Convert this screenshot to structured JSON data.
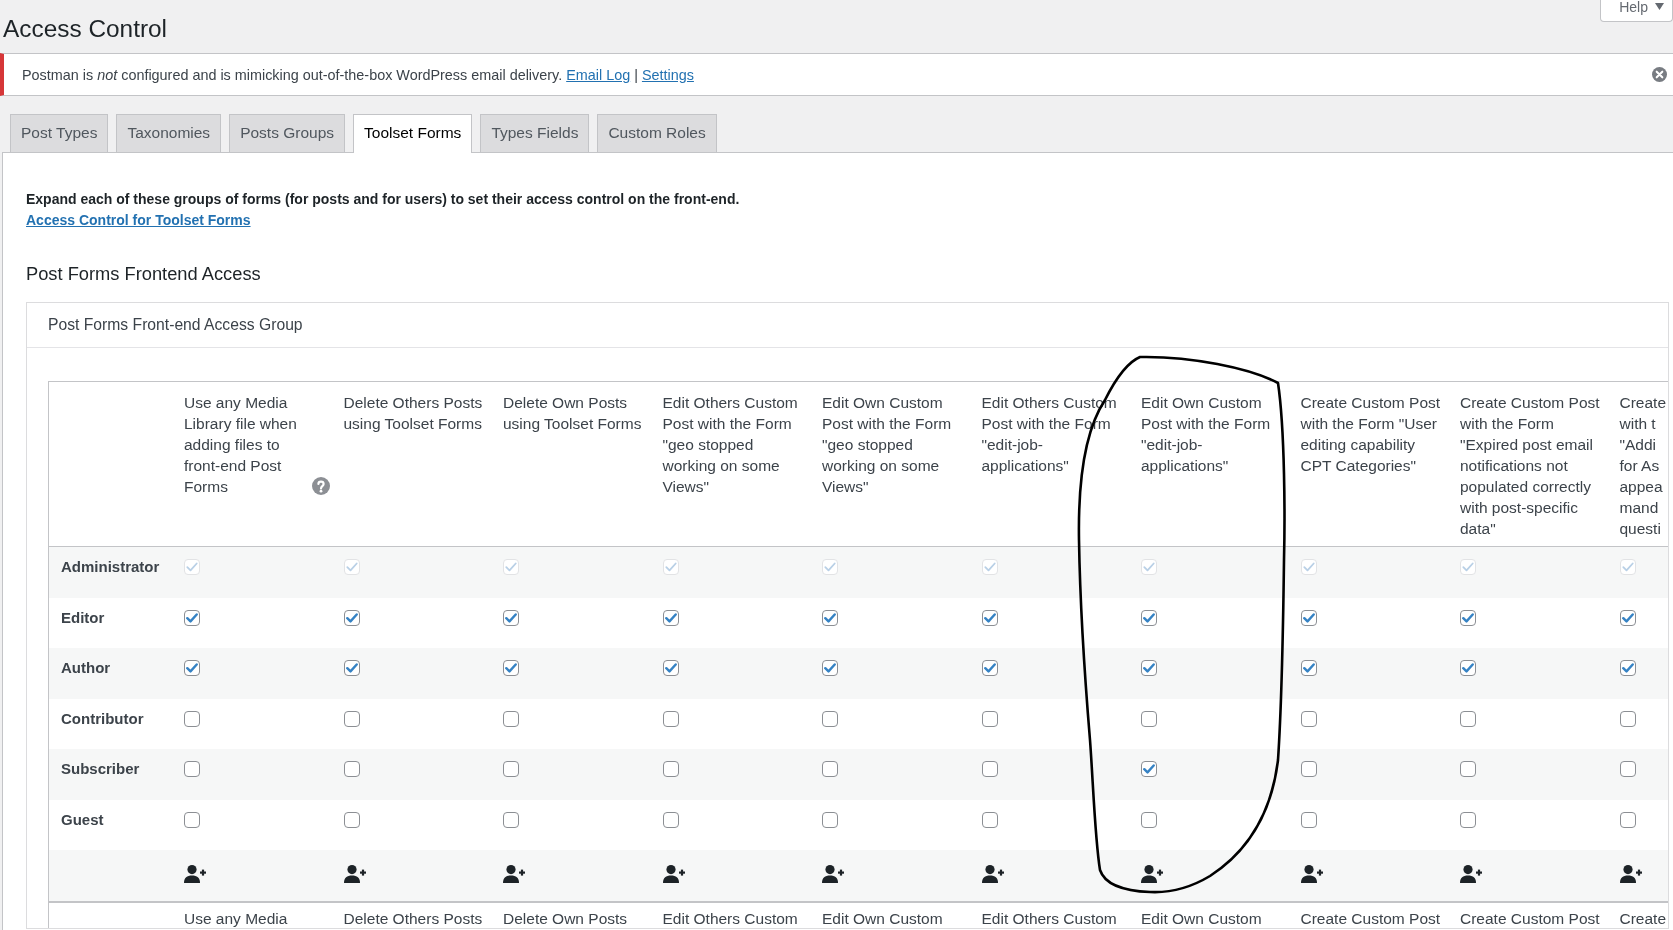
{
  "page": {
    "title": "Access Control",
    "help_button": "Help"
  },
  "notice": {
    "message": "Postman is *not* configured and is mimicking out-of-the-box WordPress email delivery.",
    "links": [
      "Email Log",
      "Settings"
    ],
    "separator": "|"
  },
  "tabs": [
    {
      "label": "Post Types",
      "selected": false
    },
    {
      "label": "Taxonomies",
      "selected": false
    },
    {
      "label": "Posts Groups",
      "selected": false
    },
    {
      "label": "Toolset Forms",
      "selected": true
    },
    {
      "label": "Types Fields",
      "selected": false
    },
    {
      "label": "Custom Roles",
      "selected": false
    }
  ],
  "intro": {
    "text": "Expand each of these groups of forms (for posts and for users) to set their access control on the front-end.",
    "link": "Access Control for Toolset Forms"
  },
  "section_title": "Post Forms Frontend Access",
  "group": {
    "title": "Post Forms Front-end Access Group",
    "columns": [
      {
        "label": "Use any Media Library file when adding files to front-end Post Forms",
        "help": true
      },
      {
        "label": "Delete Others Posts using Toolset Forms",
        "help": false
      },
      {
        "label": "Delete Own Posts using Toolset Forms",
        "help": false
      },
      {
        "label": "Edit Others Custom Post with the Form \"geo stopped working on some Views\"",
        "help": false
      },
      {
        "label": "Edit Own Custom Post with the Form \"geo stopped working on some Views\"",
        "help": false
      },
      {
        "label": "Edit Others Custom Post with the Form \"edit-job-applications\"",
        "help": false
      },
      {
        "label": "Edit Own Custom Post with the Form \"edit-job-applications\"",
        "help": false
      },
      {
        "label": "Create Custom Post with the Form \"User editing capability CPT Categories\"",
        "help": false
      },
      {
        "label": "Create Custom Post with the Form \"Expired post email notifications not populated correctly with post-specific data\"",
        "help": false
      },
      {
        "lines": [
          "Create",
          "with t",
          "\"Addi",
          "for As",
          "appea",
          "mand",
          "questi"
        ],
        "help": false
      }
    ],
    "rows": [
      {
        "role": "Administrator",
        "disabled": true,
        "checks": [
          true,
          true,
          true,
          true,
          true,
          true,
          true,
          true,
          true,
          true
        ]
      },
      {
        "role": "Editor",
        "disabled": false,
        "checks": [
          true,
          true,
          true,
          true,
          true,
          true,
          true,
          true,
          true,
          true
        ]
      },
      {
        "role": "Author",
        "disabled": false,
        "checks": [
          true,
          true,
          true,
          true,
          true,
          true,
          true,
          true,
          true,
          true
        ]
      },
      {
        "role": "Contributor",
        "disabled": false,
        "checks": [
          false,
          false,
          false,
          false,
          false,
          false,
          false,
          false,
          false,
          false
        ]
      },
      {
        "role": "Subscriber",
        "disabled": false,
        "checks": [
          false,
          false,
          false,
          false,
          false,
          false,
          true,
          false,
          false,
          false
        ]
      },
      {
        "role": "Guest",
        "disabled": false,
        "checks": [
          false,
          false,
          false,
          false,
          false,
          false,
          false,
          false,
          false,
          false
        ]
      }
    ],
    "next_table": {
      "column_headers": [
        "Use any Media",
        "Delete Others Posts",
        "Delete Own Posts",
        "Edit Others Custom",
        "Edit Own Custom",
        "Edit Others Custom",
        "Edit Own Custom",
        "Create Custom Post",
        "Create Custom Post",
        "Create"
      ]
    }
  }
}
